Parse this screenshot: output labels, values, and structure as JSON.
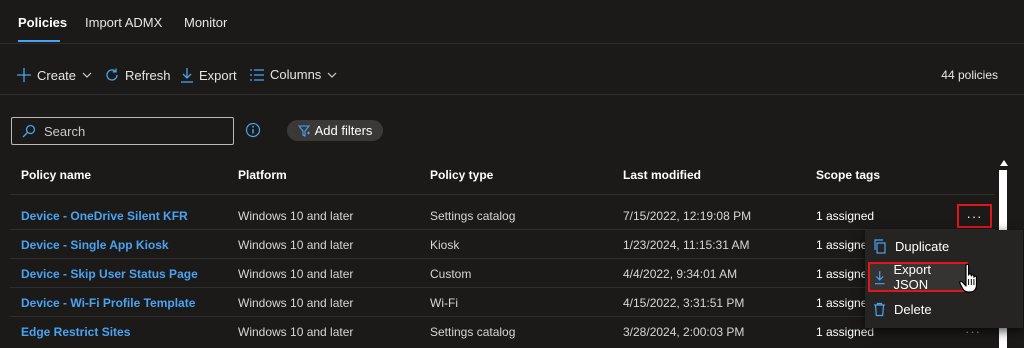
{
  "tabs": [
    "Policies",
    "Import ADMX",
    "Monitor"
  ],
  "toolbar": {
    "create": "Create",
    "refresh": "Refresh",
    "export": "Export",
    "columns": "Columns",
    "count": "44 policies"
  },
  "search": {
    "placeholder": "Search"
  },
  "filters": {
    "label": "Add filters"
  },
  "table": {
    "headers": [
      "Policy name",
      "Platform",
      "Policy type",
      "Last modified",
      "Scope tags"
    ],
    "rows": [
      {
        "name": "Device - OneDrive Silent KFR",
        "platform": "Windows 10 and later",
        "type": "Settings catalog",
        "modified": "7/15/2022, 12:19:08 PM",
        "scope": "1 assigned"
      },
      {
        "name": "Device - Single App Kiosk",
        "platform": "Windows 10 and later",
        "type": "Kiosk",
        "modified": "1/23/2024, 11:15:31 AM",
        "scope": "1 assigned"
      },
      {
        "name": "Device - Skip User Status Page",
        "platform": "Windows 10 and later",
        "type": "Custom",
        "modified": "4/4/2022, 9:34:01 AM",
        "scope": "1 assigned"
      },
      {
        "name": "Device - Wi-Fi Profile Template",
        "platform": "Windows 10 and later",
        "type": "Wi-Fi",
        "modified": "4/15/2022, 3:31:51 PM",
        "scope": "1 assigned"
      },
      {
        "name": "Edge Restrict Sites",
        "platform": "Windows 10 and later",
        "type": "Settings catalog",
        "modified": "3/28/2024, 2:00:03 PM",
        "scope": "1 assigned"
      }
    ],
    "more": "···"
  },
  "context_menu": {
    "duplicate": "Duplicate",
    "export_json": "Export JSON",
    "delete": "Delete"
  },
  "colors": {
    "accent": "#4aa3f0",
    "highlight_border": "#e0161b",
    "background": "#1b1a19"
  },
  "icons": [
    "plus-icon",
    "chevron-down-icon",
    "refresh-icon",
    "download-icon",
    "columns-icon",
    "search-icon",
    "info-icon",
    "filter-icon",
    "copy-icon",
    "trash-icon",
    "hand-cursor-icon"
  ]
}
